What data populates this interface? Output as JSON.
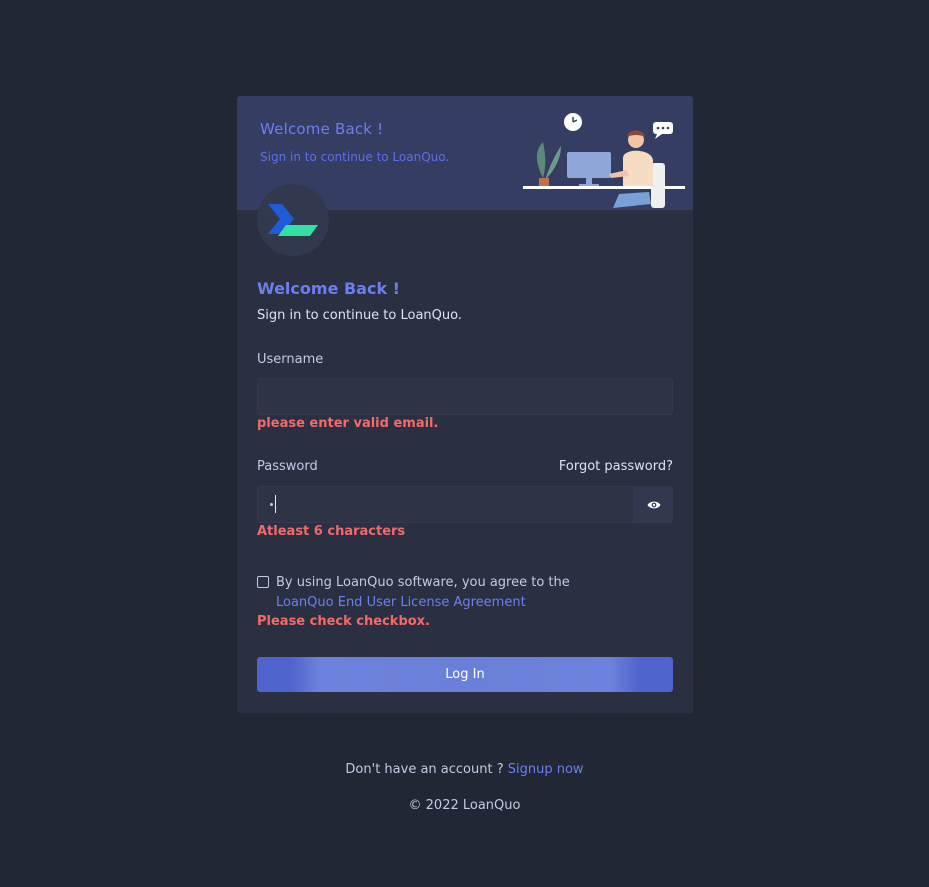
{
  "banner": {
    "title": "Welcome Back !",
    "subtitle": "Sign in to continue to LoanQuo."
  },
  "heading": {
    "title": "Welcome Back !",
    "subtitle": "Sign in to continue to LoanQuo."
  },
  "form": {
    "username_label": "Username",
    "username_value": "",
    "username_error": "please enter valid email.",
    "password_label": "Password",
    "forgot_password": "Forgot password?",
    "password_error": "Atleast 6 characters",
    "agree_text": "By using LoanQuo software, you agree to the",
    "eula_link": "LoanQuo End User License Agreement",
    "checkbox_error": "Please check checkbox.",
    "login_button": "Log In"
  },
  "footer": {
    "no_account": "Don't have an account ?",
    "signup_link": "Signup now",
    "copyright": "© 2022 LoanQuo"
  },
  "colors": {
    "background": "#222736",
    "card": "#2a3042",
    "banner": "#353d63",
    "accent": "#6c7ff0",
    "error": "#f46a6a",
    "logo_blue": "#1e5bd8",
    "logo_green": "#34e0a1"
  },
  "icons": {
    "logo": "loanquo-chevron-logo",
    "password_toggle": "eye-icon"
  }
}
